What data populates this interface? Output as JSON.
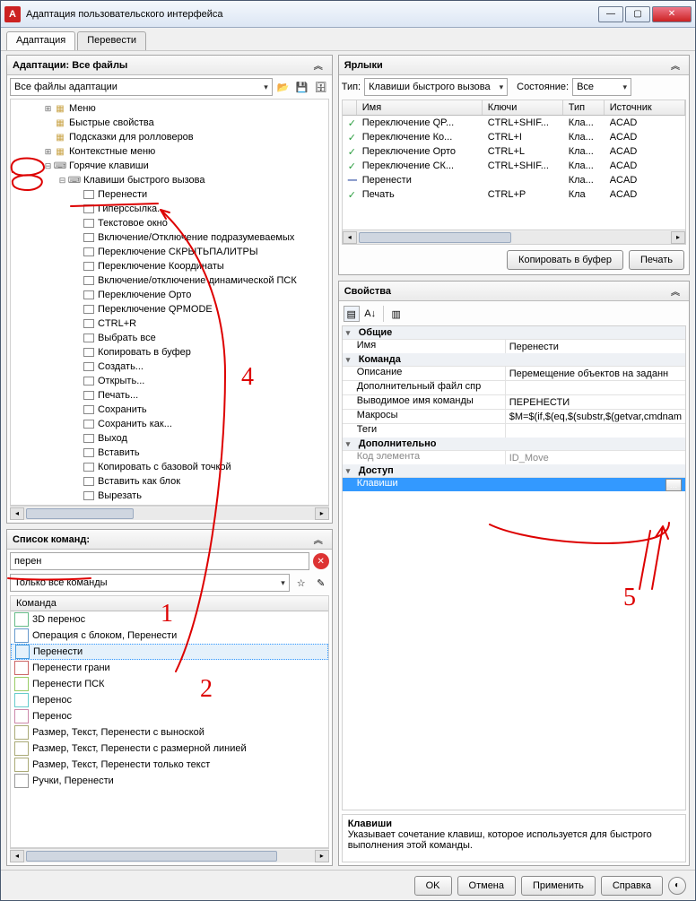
{
  "window": {
    "title": "Адаптация пользовательского интерфейса"
  },
  "tabs": [
    "Адаптация",
    "Перевести"
  ],
  "adaptations": {
    "title": "Адаптации: Все файлы",
    "combo": "Все файлы адаптации",
    "tree": [
      {
        "depth": 2,
        "twist": "+",
        "icon": "menu",
        "label": "Меню"
      },
      {
        "depth": 2,
        "twist": "",
        "icon": "prop",
        "label": "Быстрые свойства"
      },
      {
        "depth": 2,
        "twist": "",
        "icon": "tip",
        "label": "Подсказки для ролловеров"
      },
      {
        "depth": 2,
        "twist": "+",
        "icon": "ctx",
        "label": "Контекстные меню"
      },
      {
        "depth": 2,
        "twist": "-",
        "icon": "key",
        "label": "Горячие клавиши"
      },
      {
        "depth": 3,
        "twist": "-",
        "icon": "key",
        "label": "Клавиши быстрого вызова"
      },
      {
        "depth": 4,
        "twist": "",
        "icon": "box",
        "label": "Перенести"
      },
      {
        "depth": 4,
        "twist": "",
        "icon": "box",
        "label": "Гиперссылка..."
      },
      {
        "depth": 4,
        "twist": "",
        "icon": "box",
        "label": "Текстовое окно"
      },
      {
        "depth": 4,
        "twist": "",
        "icon": "box",
        "label": "Включение/Отключение подразумеваемых"
      },
      {
        "depth": 4,
        "twist": "",
        "icon": "box",
        "label": "Переключение СКРЫТЬПАЛИТРЫ"
      },
      {
        "depth": 4,
        "twist": "",
        "icon": "box",
        "label": "Переключение Координаты"
      },
      {
        "depth": 4,
        "twist": "",
        "icon": "box",
        "label": "Включение/отключение динамической ПСК"
      },
      {
        "depth": 4,
        "twist": "",
        "icon": "box",
        "label": "Переключение Орто"
      },
      {
        "depth": 4,
        "twist": "",
        "icon": "box",
        "label": "Переключение QPMODE"
      },
      {
        "depth": 4,
        "twist": "",
        "icon": "box",
        "label": "CTRL+R"
      },
      {
        "depth": 4,
        "twist": "",
        "icon": "box",
        "label": "Выбрать все"
      },
      {
        "depth": 4,
        "twist": "",
        "icon": "box",
        "label": "Копировать в буфер"
      },
      {
        "depth": 4,
        "twist": "",
        "icon": "box",
        "label": "Создать..."
      },
      {
        "depth": 4,
        "twist": "",
        "icon": "box",
        "label": "Открыть..."
      },
      {
        "depth": 4,
        "twist": "",
        "icon": "box",
        "label": "Печать..."
      },
      {
        "depth": 4,
        "twist": "",
        "icon": "box",
        "label": "Сохранить"
      },
      {
        "depth": 4,
        "twist": "",
        "icon": "box",
        "label": "Сохранить как..."
      },
      {
        "depth": 4,
        "twist": "",
        "icon": "box",
        "label": "Выход"
      },
      {
        "depth": 4,
        "twist": "",
        "icon": "box",
        "label": "Вставить"
      },
      {
        "depth": 4,
        "twist": "",
        "icon": "box",
        "label": "Копировать с базовой точкой"
      },
      {
        "depth": 4,
        "twist": "",
        "icon": "box",
        "label": "Вставить как блок"
      },
      {
        "depth": 4,
        "twist": "",
        "icon": "box",
        "label": "Вырезать"
      }
    ]
  },
  "commandList": {
    "title": "Список команд:",
    "search_value": "перен",
    "filter": "Только все команды",
    "header": "Команда",
    "rows": [
      {
        "icon": "#6b8",
        "label": "3D перенос"
      },
      {
        "icon": "#69c",
        "label": "Операция с блоком, Перенести"
      },
      {
        "icon": "#49d",
        "label": "Перенести",
        "sel": true
      },
      {
        "icon": "#c66",
        "label": "Перенести грани"
      },
      {
        "icon": "#9c6",
        "label": "Перенести ПСК"
      },
      {
        "icon": "#6cc",
        "label": "Перенос"
      },
      {
        "icon": "#c8a",
        "label": "Перенос"
      },
      {
        "icon": "#aa7",
        "label": "Размер, Текст, Перенести с выноской"
      },
      {
        "icon": "#aa7",
        "label": "Размер, Текст, Перенести с размерной линией"
      },
      {
        "icon": "#aa7",
        "label": "Размер, Текст, Перенести только текст"
      },
      {
        "icon": "#999",
        "label": "Ручки, Перенести"
      }
    ]
  },
  "shortcuts": {
    "title": "Ярлыки",
    "type_label": "Тип:",
    "type_value": "Клавиши быстрого вызова",
    "state_label": "Состояние:",
    "state_value": "Все",
    "cols": [
      "Имя",
      "Ключи",
      "Тип",
      "Источник"
    ],
    "rows": [
      {
        "chk": true,
        "c": [
          "Переключение QP...",
          "CTRL+SHIF...",
          "Кла...",
          "ACAD"
        ]
      },
      {
        "chk": true,
        "c": [
          "Переключение Ко...",
          "CTRL+I",
          "Кла...",
          "ACAD"
        ]
      },
      {
        "chk": true,
        "c": [
          "Переключение Орто",
          "CTRL+L",
          "Кла...",
          "ACAD"
        ]
      },
      {
        "chk": true,
        "c": [
          "Переключение СК...",
          "CTRL+SHIF...",
          "Кла...",
          "ACAD"
        ]
      },
      {
        "dash": true,
        "c": [
          "Перенести",
          "",
          "Кла...",
          "ACAD"
        ]
      },
      {
        "chk": true,
        "c": [
          "Печать",
          "CTRL+P",
          "Кла",
          "ACAD"
        ]
      }
    ],
    "copy_btn": "Копировать в буфер",
    "print_btn": "Печать"
  },
  "properties": {
    "title": "Свойства",
    "groups": [
      {
        "name": "Общие",
        "rows": [
          {
            "k": "Имя",
            "v": "Перенести"
          }
        ]
      },
      {
        "name": "Команда",
        "rows": [
          {
            "k": "Описание",
            "v": "Перемещение объектов на заданн"
          },
          {
            "k": "Дополнительный файл спр",
            "v": ""
          },
          {
            "k": "Выводимое имя команды",
            "v": "ПЕРЕНЕСТИ"
          },
          {
            "k": "Макросы",
            "v": "$M=$(if,$(eq,$(substr,$(getvar,cmdnam"
          },
          {
            "k": "Теги",
            "v": ""
          }
        ]
      },
      {
        "name": "Дополнительно",
        "rows": [
          {
            "k": "Код элемента",
            "v": "ID_Move",
            "ro": true
          }
        ]
      },
      {
        "name": "Доступ",
        "rows": [
          {
            "k": "Клавиши",
            "v": "",
            "sel": true,
            "btn": true
          }
        ]
      }
    ],
    "help_title": "Клавиши",
    "help_text": "Указывает сочетание клавиш, которое используется для быстрого выполнения этой команды."
  },
  "bottom": {
    "ok": "OK",
    "cancel": "Отмена",
    "apply": "Применить",
    "help": "Справка"
  },
  "annot": {
    "n1": "1",
    "n2": "2",
    "n4": "4",
    "n5": "5"
  }
}
